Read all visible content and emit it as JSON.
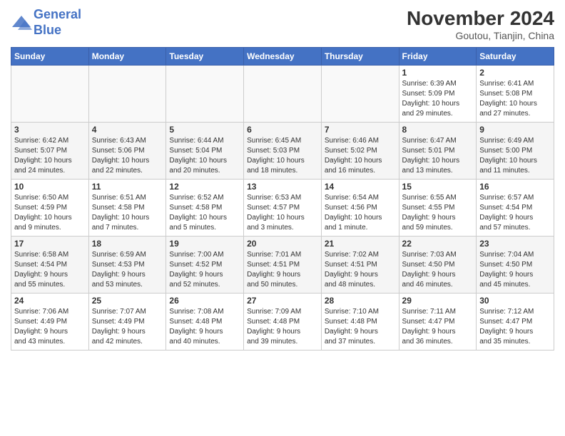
{
  "header": {
    "logo_line1": "General",
    "logo_line2": "Blue",
    "month_year": "November 2024",
    "location": "Goutou, Tianjin, China"
  },
  "weekdays": [
    "Sunday",
    "Monday",
    "Tuesday",
    "Wednesday",
    "Thursday",
    "Friday",
    "Saturday"
  ],
  "weeks": [
    [
      {
        "day": "",
        "info": ""
      },
      {
        "day": "",
        "info": ""
      },
      {
        "day": "",
        "info": ""
      },
      {
        "day": "",
        "info": ""
      },
      {
        "day": "",
        "info": ""
      },
      {
        "day": "1",
        "info": "Sunrise: 6:39 AM\nSunset: 5:09 PM\nDaylight: 10 hours\nand 29 minutes."
      },
      {
        "day": "2",
        "info": "Sunrise: 6:41 AM\nSunset: 5:08 PM\nDaylight: 10 hours\nand 27 minutes."
      }
    ],
    [
      {
        "day": "3",
        "info": "Sunrise: 6:42 AM\nSunset: 5:07 PM\nDaylight: 10 hours\nand 24 minutes."
      },
      {
        "day": "4",
        "info": "Sunrise: 6:43 AM\nSunset: 5:06 PM\nDaylight: 10 hours\nand 22 minutes."
      },
      {
        "day": "5",
        "info": "Sunrise: 6:44 AM\nSunset: 5:04 PM\nDaylight: 10 hours\nand 20 minutes."
      },
      {
        "day": "6",
        "info": "Sunrise: 6:45 AM\nSunset: 5:03 PM\nDaylight: 10 hours\nand 18 minutes."
      },
      {
        "day": "7",
        "info": "Sunrise: 6:46 AM\nSunset: 5:02 PM\nDaylight: 10 hours\nand 16 minutes."
      },
      {
        "day": "8",
        "info": "Sunrise: 6:47 AM\nSunset: 5:01 PM\nDaylight: 10 hours\nand 13 minutes."
      },
      {
        "day": "9",
        "info": "Sunrise: 6:49 AM\nSunset: 5:00 PM\nDaylight: 10 hours\nand 11 minutes."
      }
    ],
    [
      {
        "day": "10",
        "info": "Sunrise: 6:50 AM\nSunset: 4:59 PM\nDaylight: 10 hours\nand 9 minutes."
      },
      {
        "day": "11",
        "info": "Sunrise: 6:51 AM\nSunset: 4:58 PM\nDaylight: 10 hours\nand 7 minutes."
      },
      {
        "day": "12",
        "info": "Sunrise: 6:52 AM\nSunset: 4:58 PM\nDaylight: 10 hours\nand 5 minutes."
      },
      {
        "day": "13",
        "info": "Sunrise: 6:53 AM\nSunset: 4:57 PM\nDaylight: 10 hours\nand 3 minutes."
      },
      {
        "day": "14",
        "info": "Sunrise: 6:54 AM\nSunset: 4:56 PM\nDaylight: 10 hours\nand 1 minute."
      },
      {
        "day": "15",
        "info": "Sunrise: 6:55 AM\nSunset: 4:55 PM\nDaylight: 9 hours\nand 59 minutes."
      },
      {
        "day": "16",
        "info": "Sunrise: 6:57 AM\nSunset: 4:54 PM\nDaylight: 9 hours\nand 57 minutes."
      }
    ],
    [
      {
        "day": "17",
        "info": "Sunrise: 6:58 AM\nSunset: 4:54 PM\nDaylight: 9 hours\nand 55 minutes."
      },
      {
        "day": "18",
        "info": "Sunrise: 6:59 AM\nSunset: 4:53 PM\nDaylight: 9 hours\nand 53 minutes."
      },
      {
        "day": "19",
        "info": "Sunrise: 7:00 AM\nSunset: 4:52 PM\nDaylight: 9 hours\nand 52 minutes."
      },
      {
        "day": "20",
        "info": "Sunrise: 7:01 AM\nSunset: 4:51 PM\nDaylight: 9 hours\nand 50 minutes."
      },
      {
        "day": "21",
        "info": "Sunrise: 7:02 AM\nSunset: 4:51 PM\nDaylight: 9 hours\nand 48 minutes."
      },
      {
        "day": "22",
        "info": "Sunrise: 7:03 AM\nSunset: 4:50 PM\nDaylight: 9 hours\nand 46 minutes."
      },
      {
        "day": "23",
        "info": "Sunrise: 7:04 AM\nSunset: 4:50 PM\nDaylight: 9 hours\nand 45 minutes."
      }
    ],
    [
      {
        "day": "24",
        "info": "Sunrise: 7:06 AM\nSunset: 4:49 PM\nDaylight: 9 hours\nand 43 minutes."
      },
      {
        "day": "25",
        "info": "Sunrise: 7:07 AM\nSunset: 4:49 PM\nDaylight: 9 hours\nand 42 minutes."
      },
      {
        "day": "26",
        "info": "Sunrise: 7:08 AM\nSunset: 4:48 PM\nDaylight: 9 hours\nand 40 minutes."
      },
      {
        "day": "27",
        "info": "Sunrise: 7:09 AM\nSunset: 4:48 PM\nDaylight: 9 hours\nand 39 minutes."
      },
      {
        "day": "28",
        "info": "Sunrise: 7:10 AM\nSunset: 4:48 PM\nDaylight: 9 hours\nand 37 minutes."
      },
      {
        "day": "29",
        "info": "Sunrise: 7:11 AM\nSunset: 4:47 PM\nDaylight: 9 hours\nand 36 minutes."
      },
      {
        "day": "30",
        "info": "Sunrise: 7:12 AM\nSunset: 4:47 PM\nDaylight: 9 hours\nand 35 minutes."
      }
    ]
  ]
}
